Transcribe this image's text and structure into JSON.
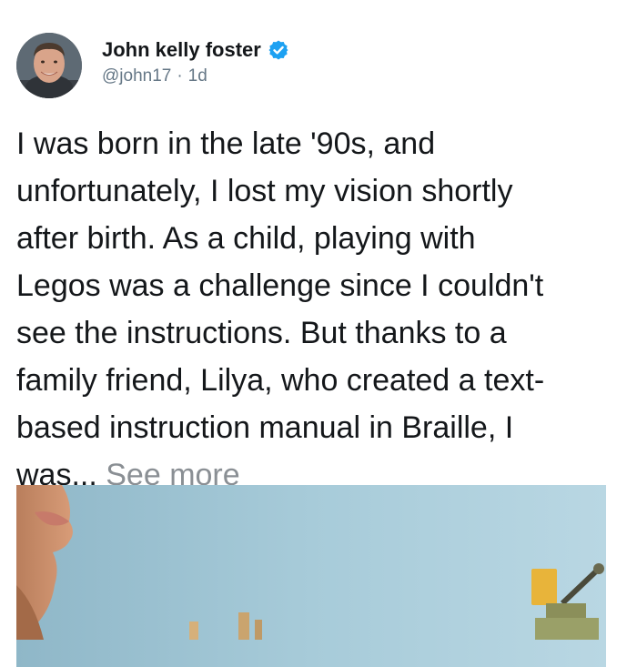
{
  "tweet": {
    "author": {
      "display_name": "John kelly foster",
      "handle": "@john17",
      "verified_icon": "verified-badge-icon",
      "avatar": "profile photo"
    },
    "separator": "·",
    "timestamp": "1d",
    "body": "I was born in the late '90s, and\nunfortunately, I lost my vision shortly\nafter birth. As a child, playing with\nLegos was a challenge since I couldn't\nsee the instructions. But thanks to a\nfamily friend, Lilya, who created a text-\nbased instruction manual in Braille, I\nwas... ",
    "see_more": "See more",
    "colors": {
      "text": "#14171a",
      "secondary": "#657786",
      "see_more": "#8a8f94",
      "verified": "#1da1f2"
    }
  }
}
